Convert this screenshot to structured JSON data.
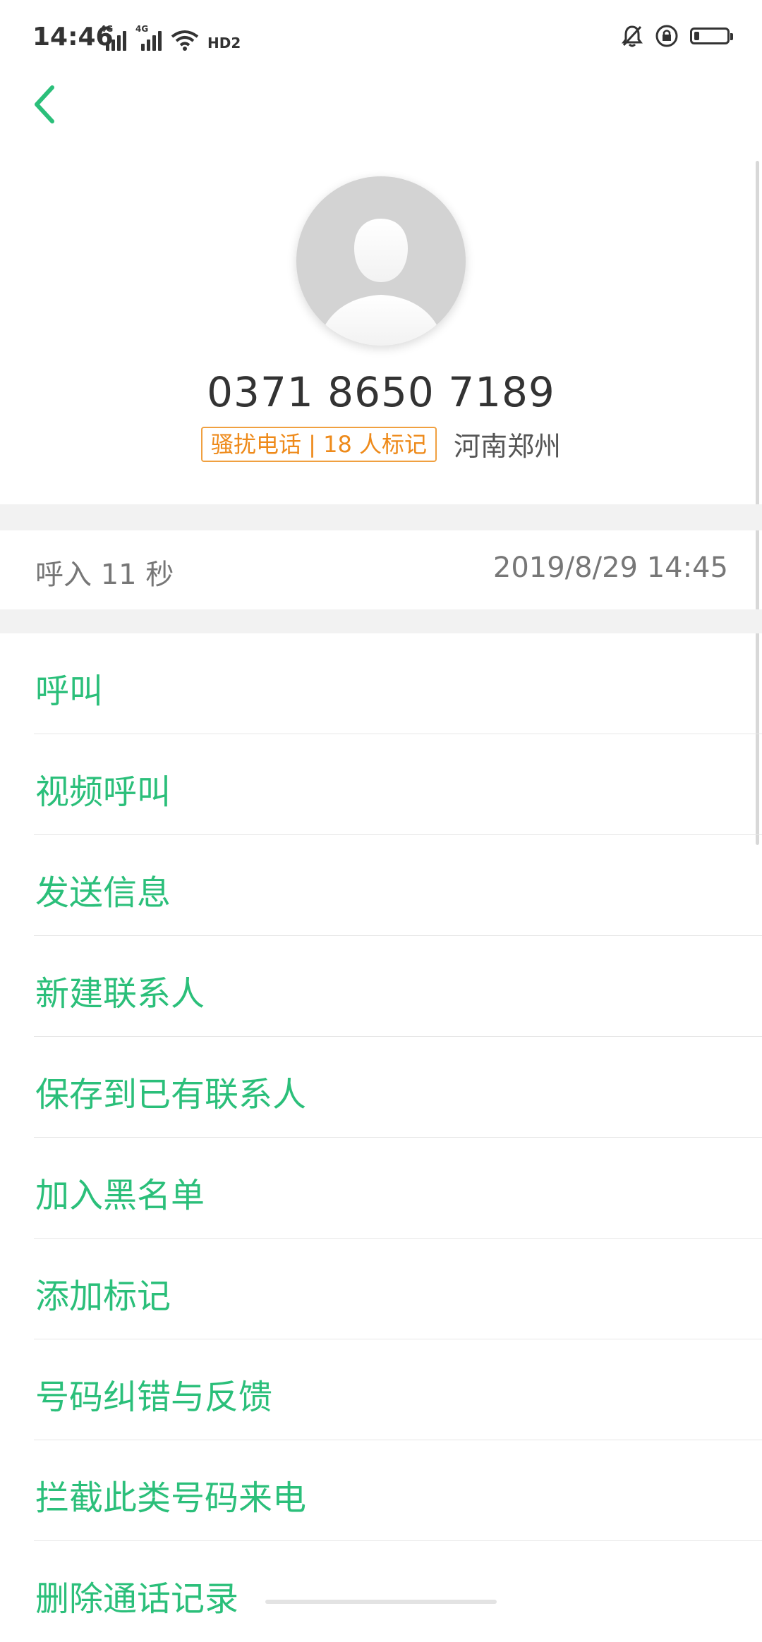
{
  "status_bar": {
    "time": "14:46",
    "network1": "4G",
    "network2": "4G",
    "hd_label": "HD2",
    "icons": [
      "signal-icon",
      "signal-icon",
      "wifi-icon",
      "hd-voice-icon",
      "bell-off-icon",
      "lock-rotation-icon",
      "battery-icon"
    ],
    "battery_level": 0.15
  },
  "header": {
    "back_icon": "chevron-left-icon",
    "accent_color": "#2bbf7a"
  },
  "contact": {
    "avatar_icon": "default-person-avatar",
    "phone_number": "0371 8650 7189",
    "spam_tag": "骚扰电话 | 18 人标记",
    "location": "河南郑州"
  },
  "call_record": {
    "direction": "呼入  11 秒",
    "datetime": "2019/8/29 14:45"
  },
  "actions": [
    {
      "label": "呼叫"
    },
    {
      "label": "视频呼叫"
    },
    {
      "label": "发送信息"
    },
    {
      "label": "新建联系人"
    },
    {
      "label": "保存到已有联系人"
    },
    {
      "label": "加入黑名单"
    },
    {
      "label": "添加标记"
    },
    {
      "label": "号码纠错与反馈"
    },
    {
      "label": "拦截此类号码来电"
    },
    {
      "label": "删除通话记录"
    }
  ]
}
